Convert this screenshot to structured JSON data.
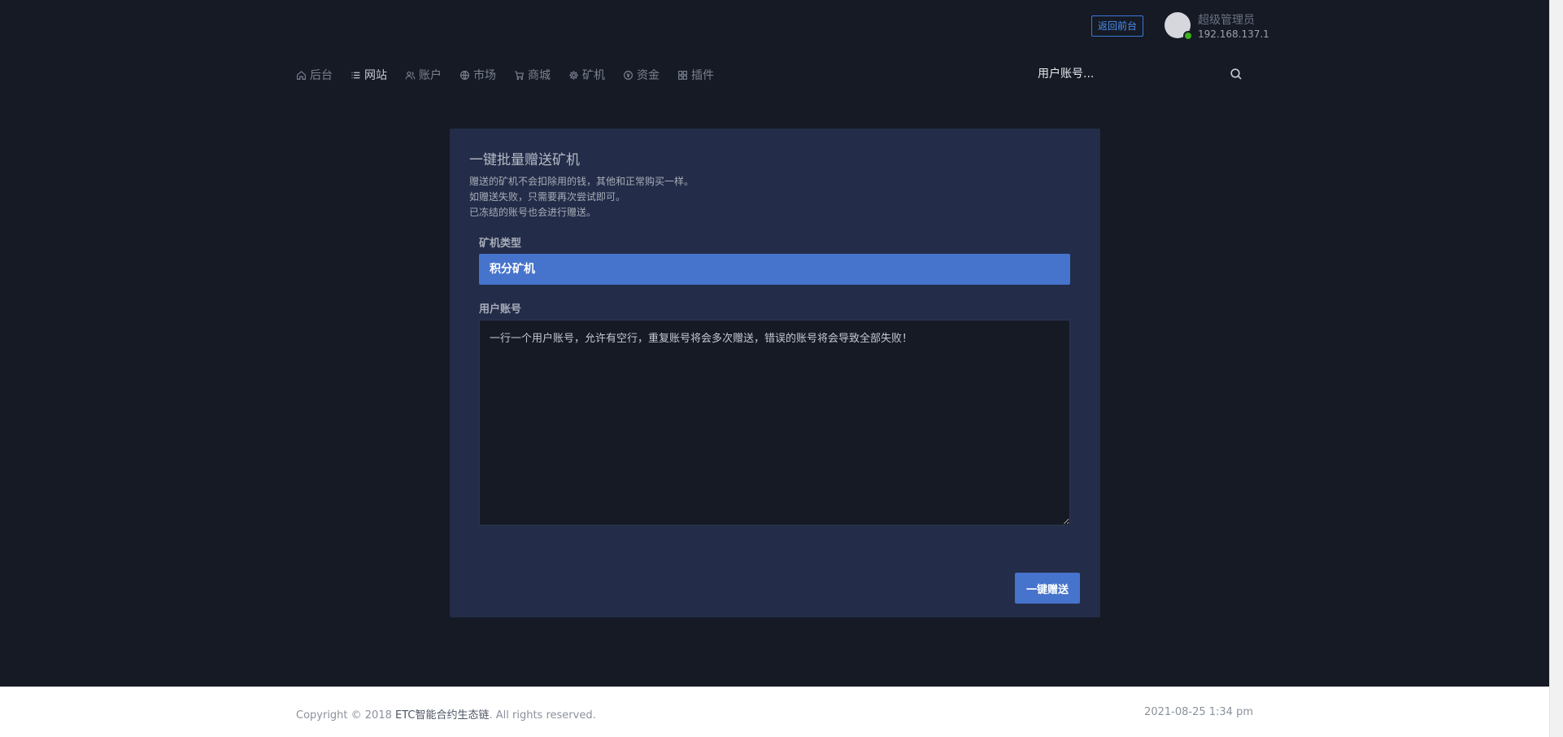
{
  "topbar": {
    "back_front_label": "返回前台",
    "user_name": "超级管理员",
    "user_ip": "192.168.137.1"
  },
  "nav": {
    "items": [
      {
        "label": "后台",
        "icon": "home-icon",
        "active": false
      },
      {
        "label": "网站",
        "icon": "list-icon",
        "active": true
      },
      {
        "label": "账户",
        "icon": "users-icon",
        "active": false
      },
      {
        "label": "市场",
        "icon": "globe-icon",
        "active": false
      },
      {
        "label": "商城",
        "icon": "cart-icon",
        "active": false
      },
      {
        "label": "矿机",
        "icon": "gear-icon",
        "active": false
      },
      {
        "label": "资金",
        "icon": "coin-icon",
        "active": false
      },
      {
        "label": "插件",
        "icon": "grid-icon",
        "active": false
      }
    ],
    "search_placeholder": "用户账号..."
  },
  "card": {
    "title": "一键批量赠送矿机",
    "desc": [
      "赠送的矿机不会扣除用的钱，其他和正常购买一样。",
      "如赠送失败，只需要再次尝试即可。",
      "已冻结的账号也会进行赠送。"
    ],
    "miner_type_label": "矿机类型",
    "miner_type_value": "积分矿机",
    "account_label": "用户账号",
    "account_placeholder": "一行一个用户账号，允许有空行，重复账号将会多次赠送，错误的账号将会导致全部失败！",
    "submit_label": "一键赠送"
  },
  "footer": {
    "copyright_prefix": "Copyright © 2018 ",
    "brand": "ETC智能合约生态链",
    "copyright_suffix": ". All rights reserved.",
    "datetime": "2021-08-25 1:34 pm"
  },
  "colors": {
    "background": "#161a25",
    "card": "#232c48",
    "accent": "#4673cc",
    "online": "#41b21a"
  }
}
